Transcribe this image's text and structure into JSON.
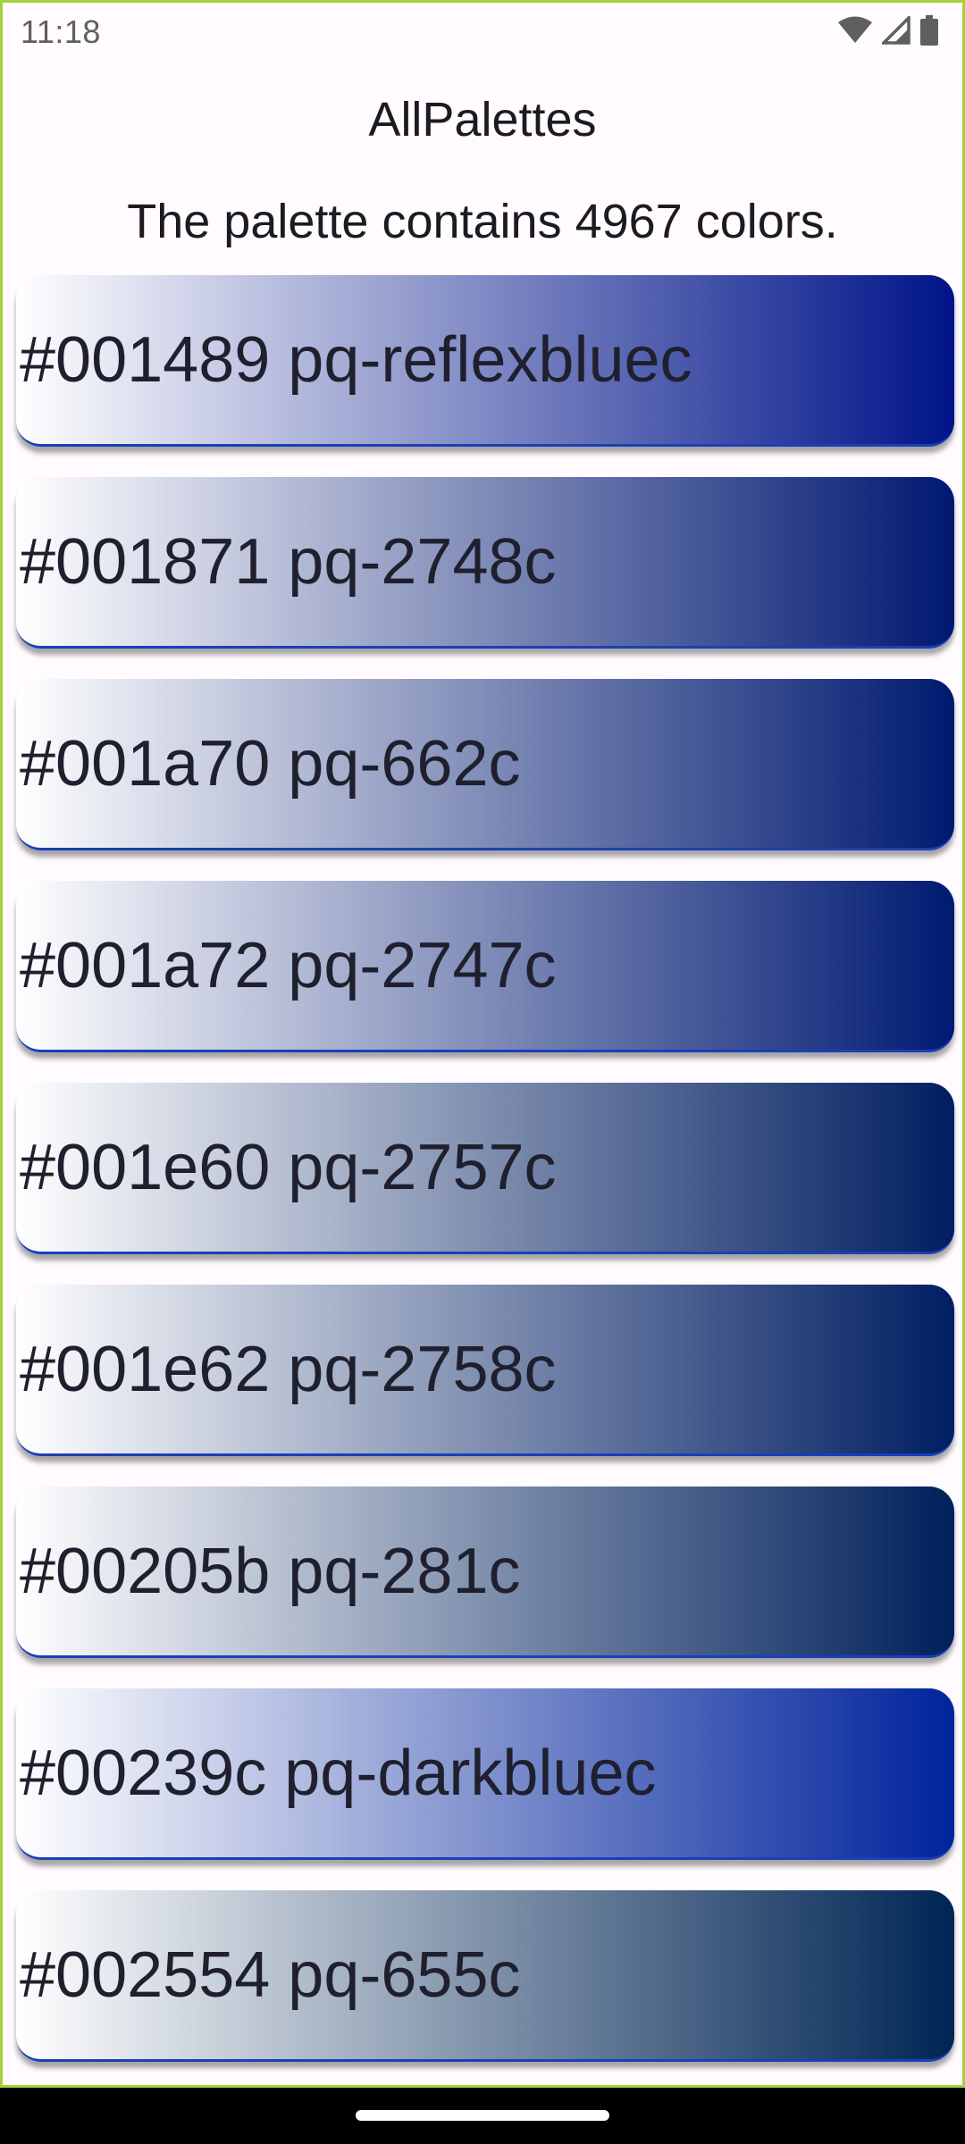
{
  "status": {
    "time": "11:18",
    "icons": [
      "wifi-icon",
      "signal-icon",
      "battery-icon"
    ]
  },
  "app": {
    "title": "AllPalettes",
    "subtitle": "The palette contains 4967 colors."
  },
  "colors": [
    {
      "hex": "#001489",
      "name": "pq-reflexbluec",
      "label": "#001489 pq-reflexbluec"
    },
    {
      "hex": "#001871",
      "name": "pq-2748c",
      "label": "#001871 pq-2748c"
    },
    {
      "hex": "#001a70",
      "name": "pq-662c",
      "label": "#001a70 pq-662c"
    },
    {
      "hex": "#001a72",
      "name": "pq-2747c",
      "label": "#001a72 pq-2747c"
    },
    {
      "hex": "#001e60",
      "name": "pq-2757c",
      "label": "#001e60 pq-2757c"
    },
    {
      "hex": "#001e62",
      "name": "pq-2758c",
      "label": "#001e62 pq-2758c"
    },
    {
      "hex": "#00205b",
      "name": "pq-281c",
      "label": "#00205b pq-281c"
    },
    {
      "hex": "#00239c",
      "name": "pq-darkbluec",
      "label": "#00239c pq-darkbluec"
    },
    {
      "hex": "#002554",
      "name": "pq-655c",
      "label": "#002554 pq-655c"
    }
  ],
  "theme": {
    "gradient_start": "#ffffff",
    "background": "#fffbfe",
    "frame_border": "#a4d23a"
  }
}
